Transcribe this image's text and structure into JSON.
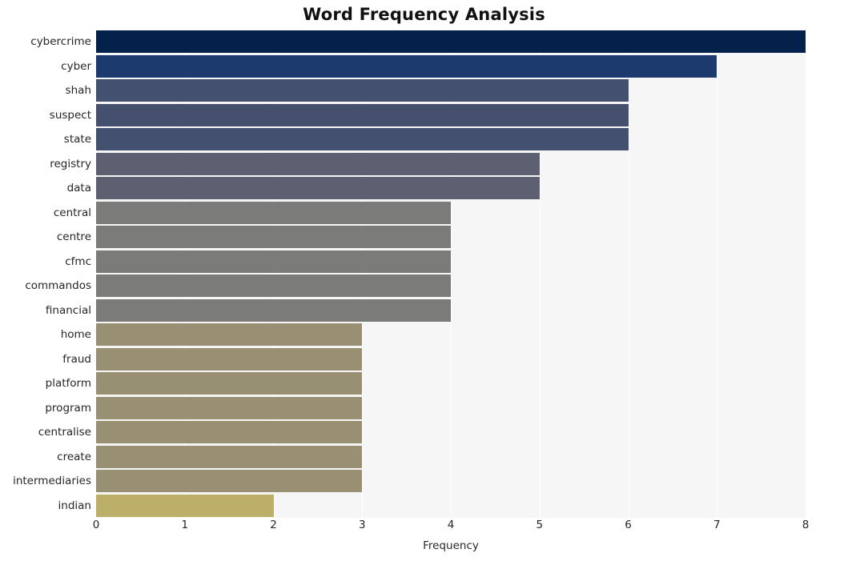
{
  "chart_data": {
    "type": "bar",
    "orientation": "horizontal",
    "title": "Word Frequency Analysis",
    "xlabel": "Frequency",
    "ylabel": "",
    "xlim": [
      0,
      8
    ],
    "xticks": [
      0,
      1,
      2,
      3,
      4,
      5,
      6,
      7,
      8
    ],
    "grid": true,
    "legend": false,
    "categories": [
      "cybercrime",
      "cyber",
      "shah",
      "suspect",
      "state",
      "registry",
      "data",
      "central",
      "centre",
      "cfmc",
      "commandos",
      "financial",
      "home",
      "fraud",
      "platform",
      "program",
      "centralise",
      "create",
      "intermediaries",
      "indian"
    ],
    "values": [
      8,
      7,
      6,
      6,
      6,
      5,
      5,
      4,
      4,
      4,
      4,
      4,
      3,
      3,
      3,
      3,
      3,
      3,
      3,
      2
    ],
    "bar_colors": [
      "#03214b",
      "#1d3a6e",
      "#44506f",
      "#454f6e",
      "#44506f",
      "#5c6070",
      "#5c6070",
      "#7b7b79",
      "#7b7b79",
      "#7b7b79",
      "#7b7b79",
      "#7b7b79",
      "#999073",
      "#999073",
      "#999073",
      "#999073",
      "#999073",
      "#999073",
      "#999073",
      "#bcaf6a"
    ],
    "plot_background": "#f6f6f7",
    "gridline_color": "#ffffff",
    "figure_background": "#ffffff"
  }
}
